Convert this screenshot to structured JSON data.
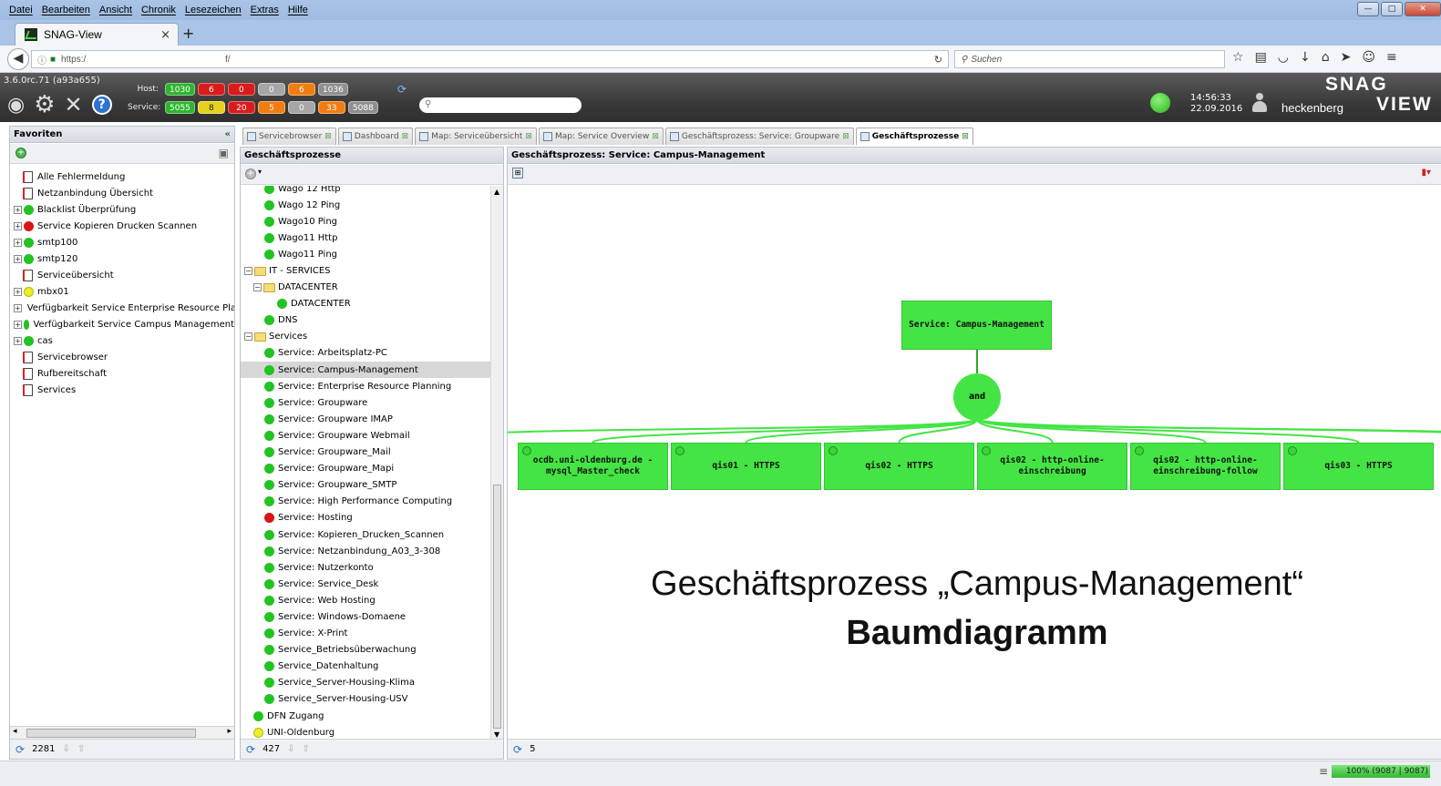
{
  "menu": [
    "Datei",
    "Bearbeiten",
    "Ansicht",
    "Chronik",
    "Lesezeichen",
    "Extras",
    "Hilfe"
  ],
  "browser": {
    "tab_title": "SNAG-View",
    "tab_close": "×",
    "new_tab": "+",
    "url": "https:/",
    "url_suffix": "f/",
    "search_placeholder": "Suchen"
  },
  "header": {
    "version": "3.6.0rc.71 (a93a655)",
    "host_label": "Host:",
    "service_label": "Service:",
    "host_counts": [
      {
        "value": "1030",
        "color": "#2fb52f"
      },
      {
        "value": "6",
        "color": "#d81b1b"
      },
      {
        "value": "0",
        "color": "#d81b1b"
      },
      {
        "value": "0",
        "color": "#a6a6a6"
      },
      {
        "value": "6",
        "color": "#f07d12"
      },
      {
        "value": "1036",
        "color": "#8f8f8f"
      }
    ],
    "service_counts": [
      {
        "value": "5055",
        "color": "#2fb52f"
      },
      {
        "value": "8",
        "color": "#e6d21a"
      },
      {
        "value": "20",
        "color": "#d81b1b"
      },
      {
        "value": "5",
        "color": "#f07d12"
      },
      {
        "value": "0",
        "color": "#a6a6a6"
      },
      {
        "value": "33",
        "color": "#f07d12"
      },
      {
        "value": "5088",
        "color": "#8f8f8f"
      }
    ],
    "time": "14:56:33",
    "date": "22.09.2016",
    "user": "heckenberg",
    "logo_top": "SNAG",
    "logo_bottom": "VIEW"
  },
  "favorites": {
    "title": "Favoriten",
    "items": [
      {
        "label": "Alle Fehlermeldung",
        "icon": "flag",
        "expand": false
      },
      {
        "label": "Netzanbindung Übersicht",
        "icon": "flag",
        "expand": false
      },
      {
        "label": "Blacklist Überprüfung",
        "icon": "green",
        "expand": true
      },
      {
        "label": "Service Kopieren Drucken Scannen",
        "icon": "red",
        "expand": true
      },
      {
        "label": "smtp100",
        "icon": "green",
        "expand": true
      },
      {
        "label": "smtp120",
        "icon": "green",
        "expand": true
      },
      {
        "label": "Serviceübersicht",
        "icon": "flag",
        "expand": false
      },
      {
        "label": "mbx01",
        "icon": "yellow",
        "expand": true
      },
      {
        "label": "Verfügbarkeit Service Enterprise Resource Pla",
        "icon": "green",
        "expand": true
      },
      {
        "label": "Verfügbarkeit Service Campus Management",
        "icon": "green",
        "expand": true
      },
      {
        "label": "cas",
        "icon": "green",
        "expand": true
      },
      {
        "label": "Servicebrowser",
        "icon": "flag",
        "expand": false
      },
      {
        "label": "Rufbereitschaft",
        "icon": "flag",
        "expand": false
      },
      {
        "label": "Services",
        "icon": "flag",
        "expand": false
      }
    ],
    "count": "2281"
  },
  "tabs": [
    {
      "label": "Servicebrowser",
      "active": false
    },
    {
      "label": "Dashboard",
      "active": false
    },
    {
      "label": "Map: Serviceübersicht",
      "active": false
    },
    {
      "label": "Map: Service Overview",
      "active": false
    },
    {
      "label": "Geschäftsprozess: Service: Groupware",
      "active": false
    },
    {
      "label": "Geschäftsprozesse",
      "active": true
    }
  ],
  "processes": {
    "title": "Geschäftsprozesse",
    "items": [
      {
        "label": "Wago 12 Http",
        "type": "green",
        "indent": 2
      },
      {
        "label": "Wago 12 Ping",
        "type": "green",
        "indent": 2
      },
      {
        "label": "Wago10 Ping",
        "type": "green",
        "indent": 2
      },
      {
        "label": "Wago11 Http",
        "type": "green",
        "indent": 2
      },
      {
        "label": "Wago11 Ping",
        "type": "green",
        "indent": 2
      },
      {
        "label": "IT - SERVICES",
        "type": "folder",
        "indent": 0
      },
      {
        "label": "DATACENTER",
        "type": "folder",
        "indent": 1
      },
      {
        "label": "DATACENTER",
        "type": "green",
        "indent": 3
      },
      {
        "label": "DNS",
        "type": "green",
        "indent": 2
      },
      {
        "label": "Services",
        "type": "folder",
        "indent": 0
      },
      {
        "label": "Service: Arbeitsplatz-PC",
        "type": "green",
        "indent": 2
      },
      {
        "label": "Service: Campus-Management",
        "type": "green",
        "indent": 2,
        "selected": true
      },
      {
        "label": "Service: Enterprise Resource Planning",
        "type": "green",
        "indent": 2
      },
      {
        "label": "Service: Groupware",
        "type": "green",
        "indent": 2
      },
      {
        "label": "Service: Groupware IMAP",
        "type": "green",
        "indent": 2
      },
      {
        "label": "Service: Groupware Webmail",
        "type": "green",
        "indent": 2
      },
      {
        "label": "Service: Groupware_Mail",
        "type": "green",
        "indent": 2
      },
      {
        "label": "Service: Groupware_Mapi",
        "type": "green",
        "indent": 2
      },
      {
        "label": "Service: Groupware_SMTP",
        "type": "green",
        "indent": 2
      },
      {
        "label": "Service: High Performance Computing",
        "type": "green",
        "indent": 2
      },
      {
        "label": "Service: Hosting",
        "type": "red",
        "indent": 2
      },
      {
        "label": "Service: Kopieren_Drucken_Scannen",
        "type": "green",
        "indent": 2
      },
      {
        "label": "Service: Netzanbindung_A03_3-308",
        "type": "green",
        "indent": 2
      },
      {
        "label": "Service: Nutzerkonto",
        "type": "green",
        "indent": 2
      },
      {
        "label": "Service: Service_Desk",
        "type": "green",
        "indent": 2
      },
      {
        "label": "Service: Web Hosting",
        "type": "green",
        "indent": 2
      },
      {
        "label": "Service: Windows-Domaene",
        "type": "green",
        "indent": 2
      },
      {
        "label": "Service: X-Print",
        "type": "green",
        "indent": 2
      },
      {
        "label": "Service_Betriebsüberwachung",
        "type": "green",
        "indent": 2
      },
      {
        "label": "Service_Datenhaltung",
        "type": "green",
        "indent": 2
      },
      {
        "label": "Service_Server-Housing-Klima",
        "type": "green",
        "indent": 2
      },
      {
        "label": "Service_Server-Housing-USV",
        "type": "green",
        "indent": 2
      },
      {
        "label": "DFN Zugang",
        "type": "green",
        "indent": 1
      },
      {
        "label": "UNI-Oldenburg",
        "type": "yellow",
        "indent": 1
      }
    ],
    "count": "427"
  },
  "diagram": {
    "title": "Geschäftsprozess: Service: Campus-Management",
    "root": "Service: Campus-Management",
    "operator": "and",
    "children": [
      "ocdb.uni-oldenburg.de - mysql_Master_check",
      "qis01 - HTTPS",
      "qis02 - HTTPS",
      "qis02 - http-online-einschreibung",
      "qis02 - http-online-einschreibung-follow",
      "qis03 - HTTPS"
    ],
    "caption_line1": "Geschäftsprozess „Campus-Management“",
    "caption_line2": "Baumdiagramm",
    "count": "5"
  },
  "statusbar": {
    "progress_text": "100% (9087 | 9087)",
    "progress_value": 1.0
  }
}
